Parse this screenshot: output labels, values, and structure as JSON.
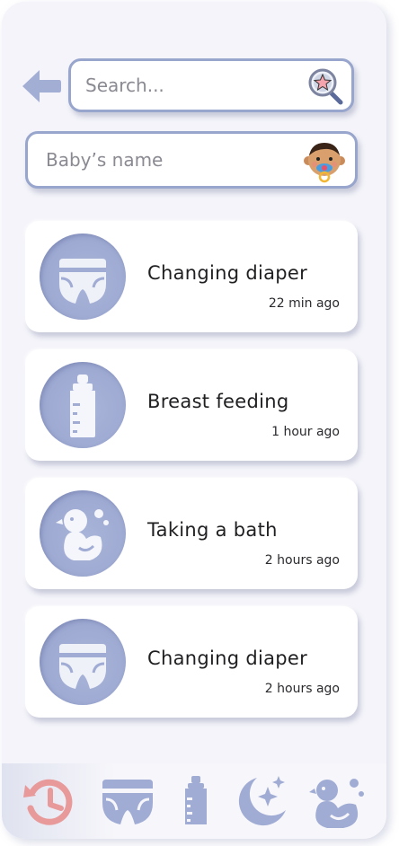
{
  "search": {
    "placeholder": "Search...",
    "icon": "magnifier-star-icon"
  },
  "baby": {
    "placeholder": "Baby’s name",
    "icon": "baby-avatar-icon"
  },
  "activities": [
    {
      "title": "Changing diaper",
      "time": "22 min ago",
      "icon": "diaper-icon"
    },
    {
      "title": "Breast feeding",
      "time": "1 hour ago",
      "icon": "bottle-icon"
    },
    {
      "title": "Taking a bath",
      "time": "2 hours ago",
      "icon": "duck-icon"
    },
    {
      "title": "Changing diaper",
      "time": "2 hours ago",
      "icon": "diaper-icon"
    }
  ],
  "nav": [
    "history-icon",
    "diaper-icon",
    "bottle-icon",
    "moon-stars-icon",
    "duck-icon"
  ],
  "colors": {
    "accent": "#98a5cc",
    "icon_fill": "#a0acd4",
    "history": "#e89a9a",
    "background": "#f4f4fa"
  }
}
